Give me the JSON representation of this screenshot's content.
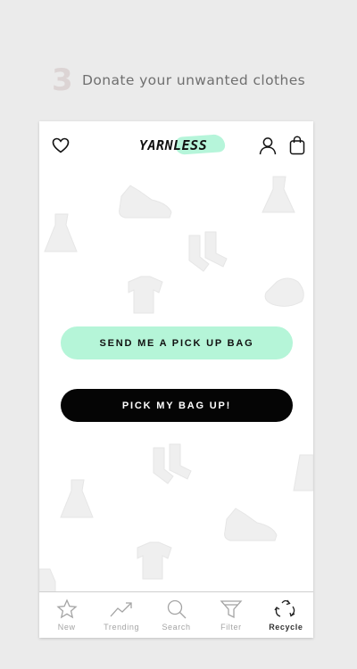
{
  "step": {
    "number": "3",
    "text": "Donate your unwanted clothes"
  },
  "header": {
    "logo_text": "YARNLESS",
    "left_icon": "heart-icon",
    "right_icons": [
      "user-icon",
      "shopping-bag-icon"
    ]
  },
  "actions": {
    "pickup_bag_label": "SEND ME A PICK UP BAG",
    "pickup_now_label": "PICK MY BAG UP!"
  },
  "tabs": [
    {
      "label": "New",
      "icon": "star-icon",
      "active": false
    },
    {
      "label": "Trending",
      "icon": "trending-icon",
      "active": false
    },
    {
      "label": "Search",
      "icon": "search-icon",
      "active": false
    },
    {
      "label": "Filter",
      "icon": "filter-icon",
      "active": false
    },
    {
      "label": "Recycle",
      "icon": "recycle-icon",
      "active": true
    }
  ],
  "colors": {
    "accent_mint": "#b5f5d8",
    "button_dark": "#050505",
    "background": "#ebebeb",
    "doodle": "#efefef"
  }
}
